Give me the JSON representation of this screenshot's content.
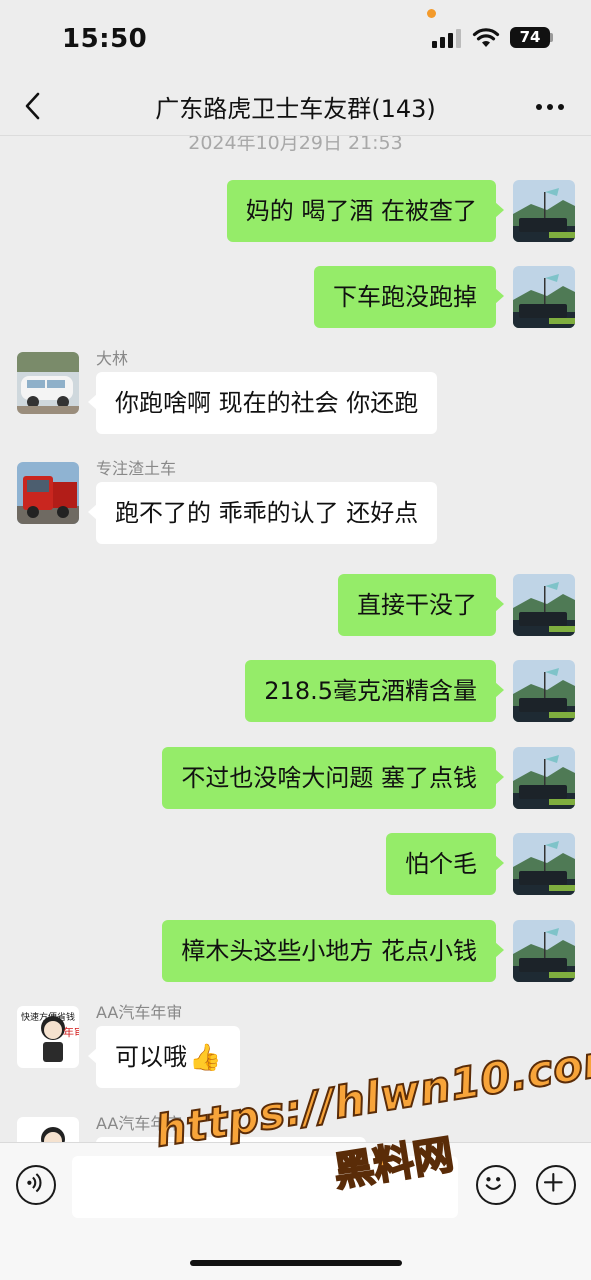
{
  "status_bar": {
    "time": "15:50",
    "battery": "74"
  },
  "header": {
    "title": "广东路虎卫士车友群(143)",
    "back_icon": "chevron-left-icon",
    "more_icon": "ellipsis-icon"
  },
  "chat": {
    "timestamp": "2024年10月29日 21:53",
    "messages": [
      {
        "side": "right",
        "text": "妈的 喝了酒 在被查了"
      },
      {
        "side": "right",
        "text": "下车跑没跑掉"
      },
      {
        "side": "left",
        "sender": "大林",
        "text": "你跑啥啊 现在的社会 你还跑"
      },
      {
        "side": "left",
        "sender": "专注渣土车",
        "text": "跑不了的 乖乖的认了 还好点"
      },
      {
        "side": "right",
        "text": "直接干没了"
      },
      {
        "side": "right",
        "text": "218.5毫克酒精含量"
      },
      {
        "side": "right",
        "text": "不过也没啥大问题 塞了点钱"
      },
      {
        "side": "right",
        "text": "怕个毛"
      },
      {
        "side": "right",
        "text": "樟木头这些小地方 花点小钱"
      },
      {
        "side": "left",
        "sender": "AA汽车年审",
        "text": "可以哦",
        "emoji": "👍"
      },
      {
        "side": "left",
        "sender": "AA汽车年审",
        "text": ""
      }
    ],
    "avatar_badge_text": {
      "vertical": "快速方便省钱",
      "stamp": "年审"
    }
  },
  "input_bar": {
    "voice_icon": "voice-icon",
    "emoji_icon": "smiley-icon",
    "plus_icon": "plus-icon"
  },
  "watermark": {
    "url": "https://hlwn10.com",
    "name": "黑料网"
  },
  "colors": {
    "background": "#ededed",
    "bubble_self": "#95ec69",
    "bubble_other": "#ffffff",
    "watermark": "#f7a43a"
  }
}
